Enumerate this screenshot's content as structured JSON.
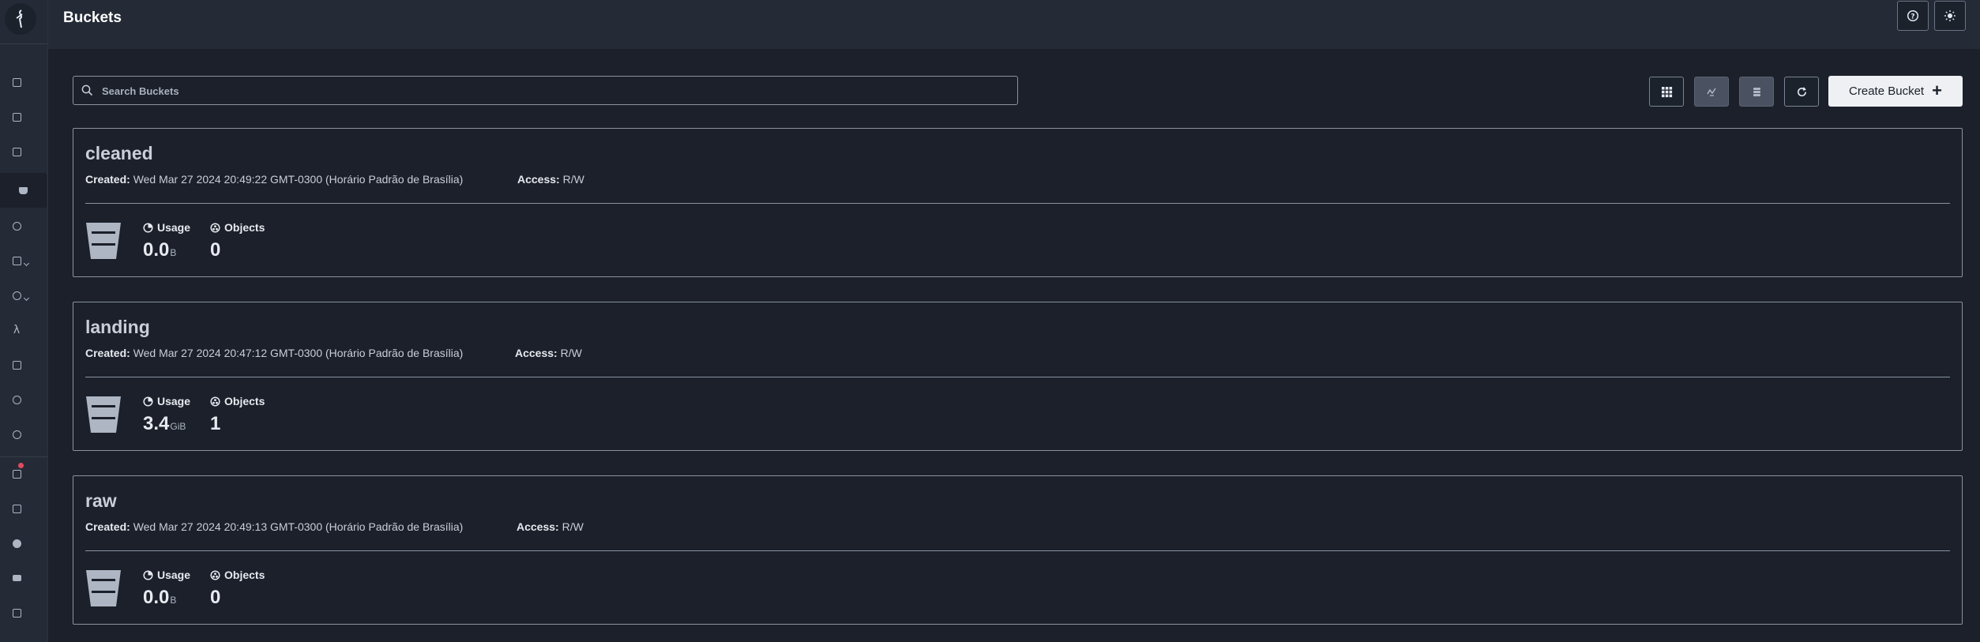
{
  "header": {
    "title": "Buckets"
  },
  "search": {
    "placeholder": "Search Buckets"
  },
  "toolbar": {
    "create_label": "Create Bucket"
  },
  "buckets": [
    {
      "name": "cleaned",
      "created_label": "Created:",
      "created": "Wed Mar 27 2024 20:49:22 GMT-0300 (Horário Padrão de Brasília)",
      "access_label": "Access:",
      "access": "R/W",
      "usage_label": "Usage",
      "usage_value": "0.0",
      "usage_unit": "B",
      "objects_label": "Objects",
      "objects_value": "0"
    },
    {
      "name": "landing",
      "created_label": "Created:",
      "created": "Wed Mar 27 2024 20:47:12 GMT-0300 (Horário Padrão de Brasília)",
      "access_label": "Access:",
      "access": "R/W",
      "usage_label": "Usage",
      "usage_value": "3.4",
      "usage_unit": "GiB",
      "objects_label": "Objects",
      "objects_value": "1"
    },
    {
      "name": "raw",
      "created_label": "Created:",
      "created": "Wed Mar 27 2024 20:49:13 GMT-0300 (Horário Padrão de Brasília)",
      "access_label": "Access:",
      "access": "R/W",
      "usage_label": "Usage",
      "usage_value": "0.0",
      "usage_unit": "B",
      "objects_label": "Objects",
      "objects_value": "0"
    }
  ],
  "icons": {
    "sidebar": [
      "dashboard-icon",
      "monitoring-icon",
      "browser-icon",
      "buckets-icon",
      "policies-icon",
      "identity-icon",
      "access-icon",
      "lambda-icon",
      "tiers-icon",
      "replication-icon",
      "settings-icon",
      "license-icon",
      "support-icon",
      "inspect-icon",
      "storage-icon",
      "documentation-icon"
    ],
    "header": [
      "help-icon",
      "theme-toggle-icon"
    ],
    "toolbar": [
      "grid-view-icon",
      "lifecycle-icon",
      "replication-rules-icon",
      "refresh-icon",
      "plus-icon"
    ]
  },
  "colors": {
    "background": "#1b202a",
    "sidebar": "#242b37",
    "accent": "#eef0f3",
    "alert": "#e04a5f"
  }
}
